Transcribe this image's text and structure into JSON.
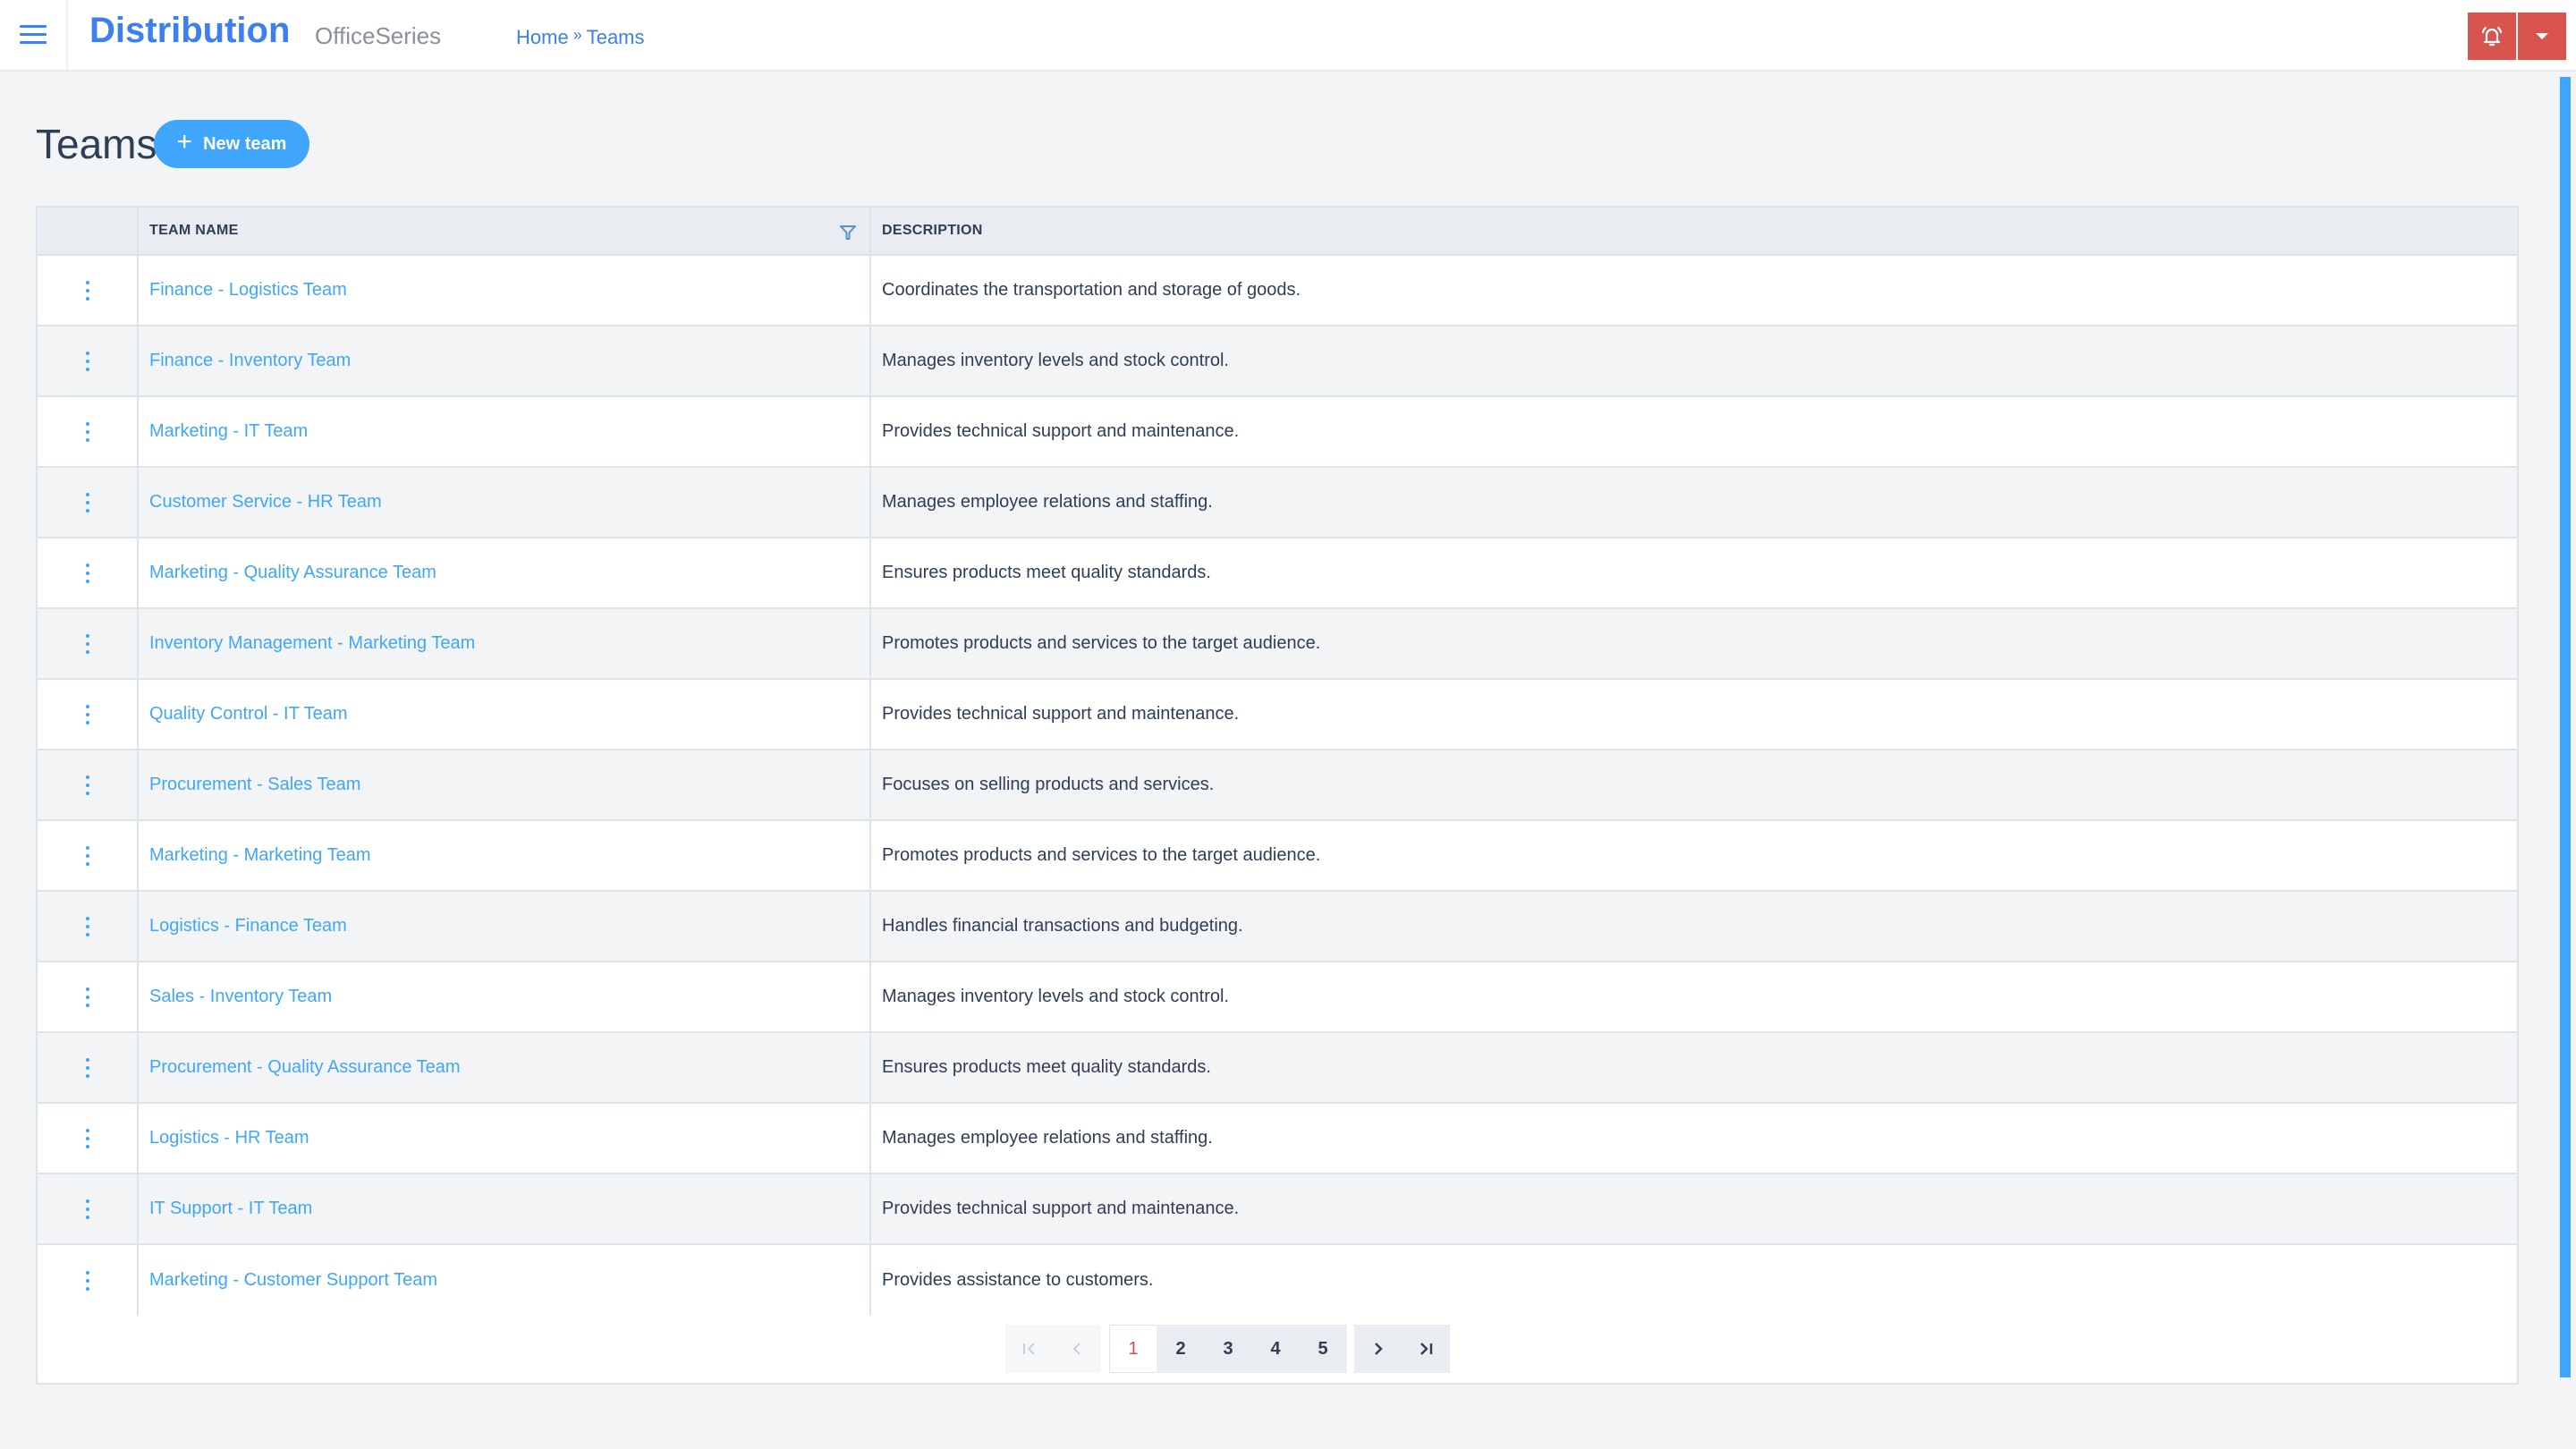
{
  "header": {
    "brand": "Distribution",
    "product": "OfficeSeries",
    "breadcrumb": [
      {
        "label": "Home"
      },
      {
        "label": "Teams"
      }
    ],
    "breadcrumb_separator": "»",
    "icons": {
      "menu": "hamburger-menu-icon",
      "alert": "bell-ringing-icon",
      "dropdown": "caret-down-icon"
    }
  },
  "page": {
    "title": "Teams",
    "new_button_label": "New team",
    "new_button_icon": "plus-icon"
  },
  "table": {
    "columns": [
      {
        "label": ""
      },
      {
        "label": "TEAM NAME",
        "filterable": true
      },
      {
        "label": "DESCRIPTION"
      }
    ],
    "rows": [
      {
        "name": "Finance - Logistics Team",
        "description": "Coordinates the transportation and storage of goods."
      },
      {
        "name": "Finance - Inventory Team",
        "description": "Manages inventory levels and stock control."
      },
      {
        "name": "Marketing - IT Team",
        "description": "Provides technical support and maintenance."
      },
      {
        "name": "Customer Service - HR Team",
        "description": "Manages employee relations and staffing."
      },
      {
        "name": "Marketing - Quality Assurance Team",
        "description": "Ensures products meet quality standards."
      },
      {
        "name": "Inventory Management - Marketing Team",
        "description": "Promotes products and services to the target audience."
      },
      {
        "name": "Quality Control - IT Team",
        "description": "Provides technical support and maintenance."
      },
      {
        "name": "Procurement - Sales Team",
        "description": "Focuses on selling products and services."
      },
      {
        "name": "Marketing - Marketing Team",
        "description": "Promotes products and services to the target audience."
      },
      {
        "name": "Logistics - Finance Team",
        "description": "Handles financial transactions and budgeting."
      },
      {
        "name": "Sales - Inventory Team",
        "description": "Manages inventory levels and stock control."
      },
      {
        "name": "Procurement - Quality Assurance Team",
        "description": "Ensures products meet quality standards."
      },
      {
        "name": "Logistics - HR Team",
        "description": "Manages employee relations and staffing."
      },
      {
        "name": "IT Support - IT Team",
        "description": "Provides technical support and maintenance."
      },
      {
        "name": "Marketing - Customer Support Team",
        "description": "Provides assistance to customers."
      }
    ]
  },
  "pagination": {
    "first_label": "|<",
    "prev_label": "<",
    "next_label": ">",
    "last_label": ">|",
    "pages": [
      "1",
      "2",
      "3",
      "4",
      "5"
    ],
    "current_page": "1"
  },
  "colors": {
    "brand": "#3b7ff0",
    "accent": "#3fa6fc",
    "alert": "#d9534f",
    "current_page": "#e0464e"
  }
}
